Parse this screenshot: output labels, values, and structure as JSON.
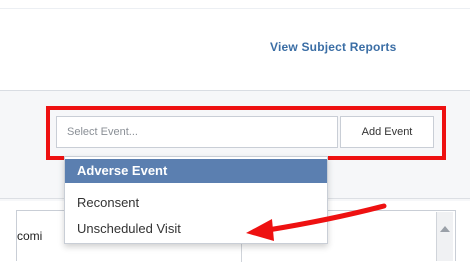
{
  "header": {
    "view_reports_label": "View Subject Reports"
  },
  "event_selector": {
    "placeholder": "Select Event...",
    "add_button_label": "Add Event"
  },
  "dropdown": {
    "options": [
      {
        "label": "Adverse Event",
        "selected": true
      },
      {
        "label": "Reconsent",
        "selected": false
      },
      {
        "label": "Unscheduled Visit",
        "selected": false
      }
    ]
  },
  "table": {
    "partial_cell_text": "comi"
  },
  "colors": {
    "link": "#3b6ea5",
    "selected_option_bg": "#5b7fb0",
    "highlight": "#ee1111"
  }
}
